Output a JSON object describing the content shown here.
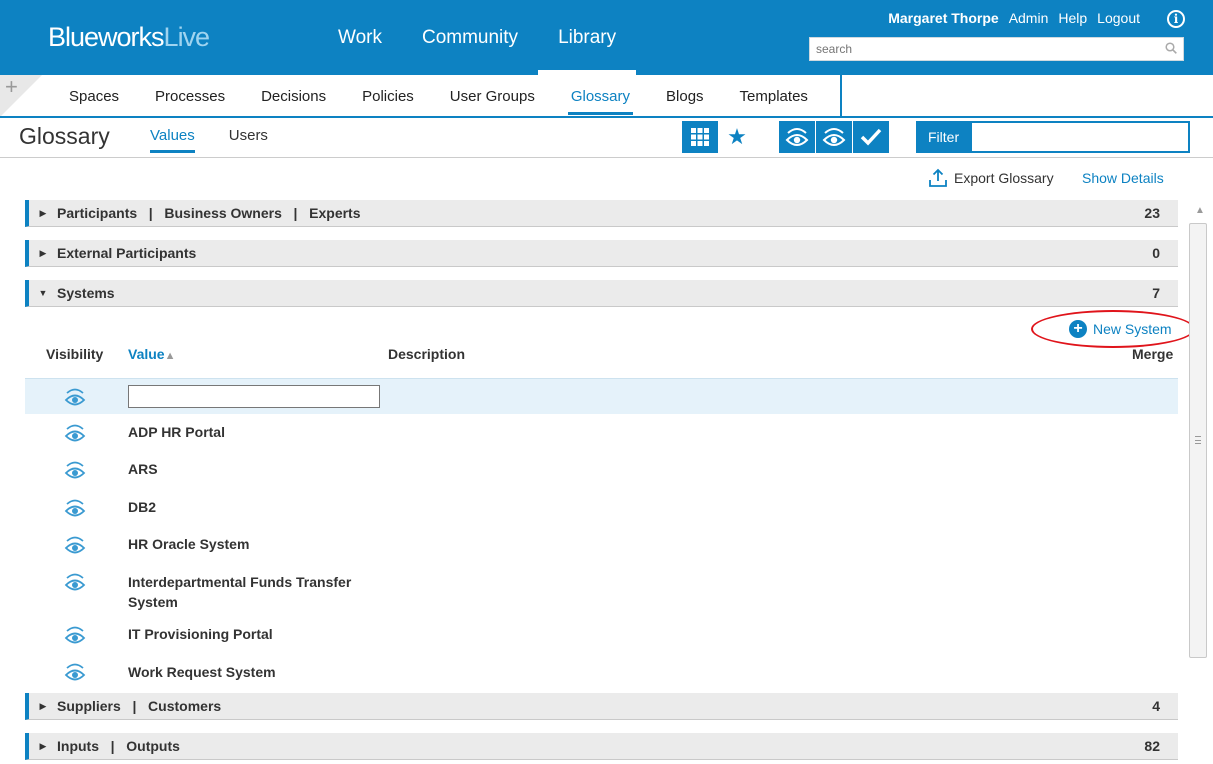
{
  "brand": {
    "logo_main": "Blueworks",
    "logo_accent": "Live"
  },
  "main_nav": [
    "Work",
    "Community",
    "Library"
  ],
  "user": {
    "name": "Margaret Thorpe",
    "links": [
      "Admin",
      "Help",
      "Logout"
    ]
  },
  "search": {
    "placeholder": "search"
  },
  "subtabs": [
    "Spaces",
    "Processes",
    "Decisions",
    "Policies",
    "User Groups",
    "Glossary",
    "Blogs",
    "Templates"
  ],
  "page": {
    "title": "Glossary",
    "view_tabs": [
      "Values",
      "Users"
    ],
    "filter_label": "Filter"
  },
  "actions": {
    "export": "Export Glossary",
    "show_details": "Show Details"
  },
  "sections": [
    {
      "title": "Participants   |   Business Owners   |   Experts",
      "count": "23",
      "expanded": false
    },
    {
      "title": "External Participants",
      "count": "0",
      "expanded": false
    },
    {
      "title": "Systems",
      "count": "7",
      "expanded": true
    },
    {
      "title": "Suppliers   |   Customers",
      "count": "4",
      "expanded": false
    },
    {
      "title": "Inputs   |   Outputs",
      "count": "82",
      "expanded": false
    }
  ],
  "systems": {
    "new_button": "New System",
    "columns": {
      "visibility": "Visibility",
      "value": "Value",
      "description": "Description",
      "merge": "Merge"
    },
    "rows": [
      "ADP HR Portal",
      "ARS",
      "DB2",
      "HR Oracle System",
      "Interdepartmental Funds Transfer System",
      "IT Provisioning Portal",
      "Work Request System"
    ]
  },
  "colors": {
    "brand_blue": "#0d82c2",
    "highlight_red": "#e0141b"
  }
}
